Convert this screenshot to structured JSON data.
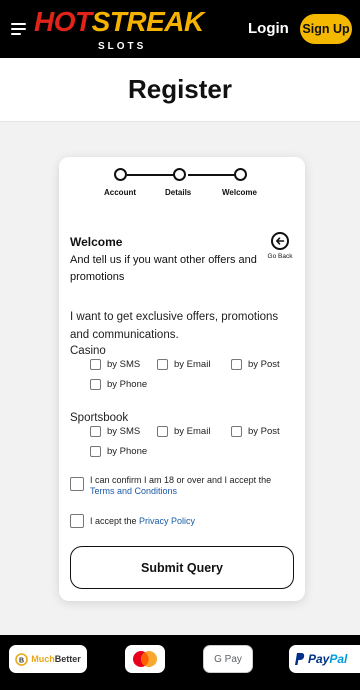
{
  "header": {
    "logo": {
      "hot": "HOT",
      "streak": "STREAK",
      "sub": "SLOTS"
    },
    "login_label": "Login",
    "signup_label": "Sign Up"
  },
  "page_title": "Register",
  "steps": [
    {
      "label": "Account"
    },
    {
      "label": "Details"
    },
    {
      "label": "Welcome"
    }
  ],
  "section": {
    "title": "Welcome",
    "text": "And tell us if you want other offers and promotions",
    "go_back_label": "Go Back"
  },
  "offers_text": "I want to get exclusive offers, promotions and communications.",
  "casino": {
    "label": "Casino",
    "options": [
      "by SMS",
      "by Email",
      "by Post",
      "by Phone"
    ]
  },
  "sportsbook": {
    "label": "Sportsbook",
    "options": [
      "by SMS",
      "by Email",
      "by Post",
      "by Phone"
    ]
  },
  "age_consent": {
    "text": "I can confirm I am 18 or over and I accept the",
    "link": "Terms and Conditions"
  },
  "privacy_consent": {
    "text": "I accept the",
    "link": "Privacy Policy"
  },
  "submit_label": "Submit Query",
  "payments": {
    "muchbetter": {
      "prefix": "Much",
      "suffix": "Better"
    },
    "googlepay": "G Pay",
    "paypal": {
      "pay": "Pay",
      "pal": "Pal"
    }
  },
  "colors": {
    "brand_red": "#e2231a",
    "brand_yellow": "#f5b800",
    "link_blue": "#1a5ba8"
  }
}
